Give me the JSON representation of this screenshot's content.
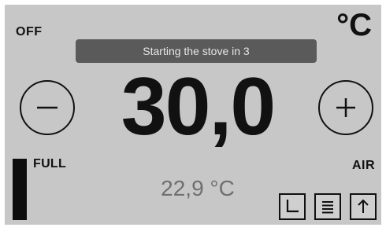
{
  "status": {
    "power": "OFF",
    "unit": "°C",
    "notification": "Starting the stove in 3"
  },
  "thermostat": {
    "setpoint": "30,0",
    "current_temperature": "22,9 °C"
  },
  "pellet_level": {
    "label": "FULL",
    "fill_fraction": 1.0
  },
  "mode": {
    "label": "AIR"
  },
  "controls": {
    "decrease_icon": "minus-icon",
    "increase_icon": "plus-icon",
    "schedule_icon": "clock-icon",
    "menu_icon": "menu-lines-icon",
    "up_icon": "arrow-up-icon"
  },
  "colors": {
    "background": "#c7c7c7",
    "toast": "#5a5a5a",
    "current_temp_text": "#6f6f6f"
  }
}
